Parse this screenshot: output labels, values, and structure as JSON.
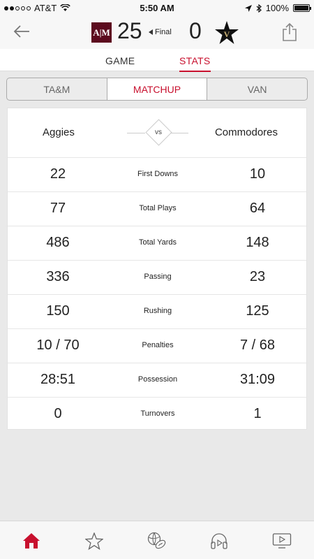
{
  "status_bar": {
    "carrier": "AT&T",
    "time": "5:50 AM",
    "battery": "100%"
  },
  "scoreboard": {
    "home_logo_text": "A|M",
    "home_score": "25",
    "status": "Final",
    "away_score": "0",
    "away_logo_letter": "V"
  },
  "main_tabs": [
    {
      "label": "GAME"
    },
    {
      "label": "STATS"
    }
  ],
  "segments": [
    {
      "label": "TA&M"
    },
    {
      "label": "MATCHUP"
    },
    {
      "label": "VAN"
    }
  ],
  "matchup": {
    "home_team": "Aggies",
    "vs": "vs",
    "away_team": "Commodores",
    "rows": [
      {
        "home": "22",
        "label": "First Downs",
        "away": "10"
      },
      {
        "home": "77",
        "label": "Total Plays",
        "away": "64"
      },
      {
        "home": "486",
        "label": "Total Yards",
        "away": "148"
      },
      {
        "home": "336",
        "label": "Passing",
        "away": "23"
      },
      {
        "home": "150",
        "label": "Rushing",
        "away": "125"
      },
      {
        "home": "10 / 70",
        "label": "Penalties",
        "away": "7 / 68"
      },
      {
        "home": "28:51",
        "label": "Possession",
        "away": "31:09"
      },
      {
        "home": "0",
        "label": "Turnovers",
        "away": "1"
      }
    ]
  },
  "tab_bar": {
    "items": [
      "home-icon",
      "star-icon",
      "sports-balls-icon",
      "headphones-icon",
      "tv-icon"
    ],
    "active_color": "#c8102e"
  },
  "colors": {
    "accent": "#c8102e",
    "home_team": "#5c0a1e"
  }
}
